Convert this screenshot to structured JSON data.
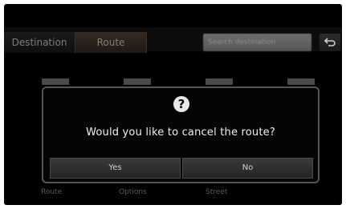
{
  "tabs": {
    "destination": "Destination",
    "route": "Route"
  },
  "search": {
    "value": "Search destination"
  },
  "background_menu": {
    "labels": [
      "Route",
      "Options",
      "Street"
    ]
  },
  "dialog": {
    "message": "Would you like to cancel the route?",
    "icon_glyph": "?",
    "yes_label": "Yes",
    "no_label": "No"
  }
}
